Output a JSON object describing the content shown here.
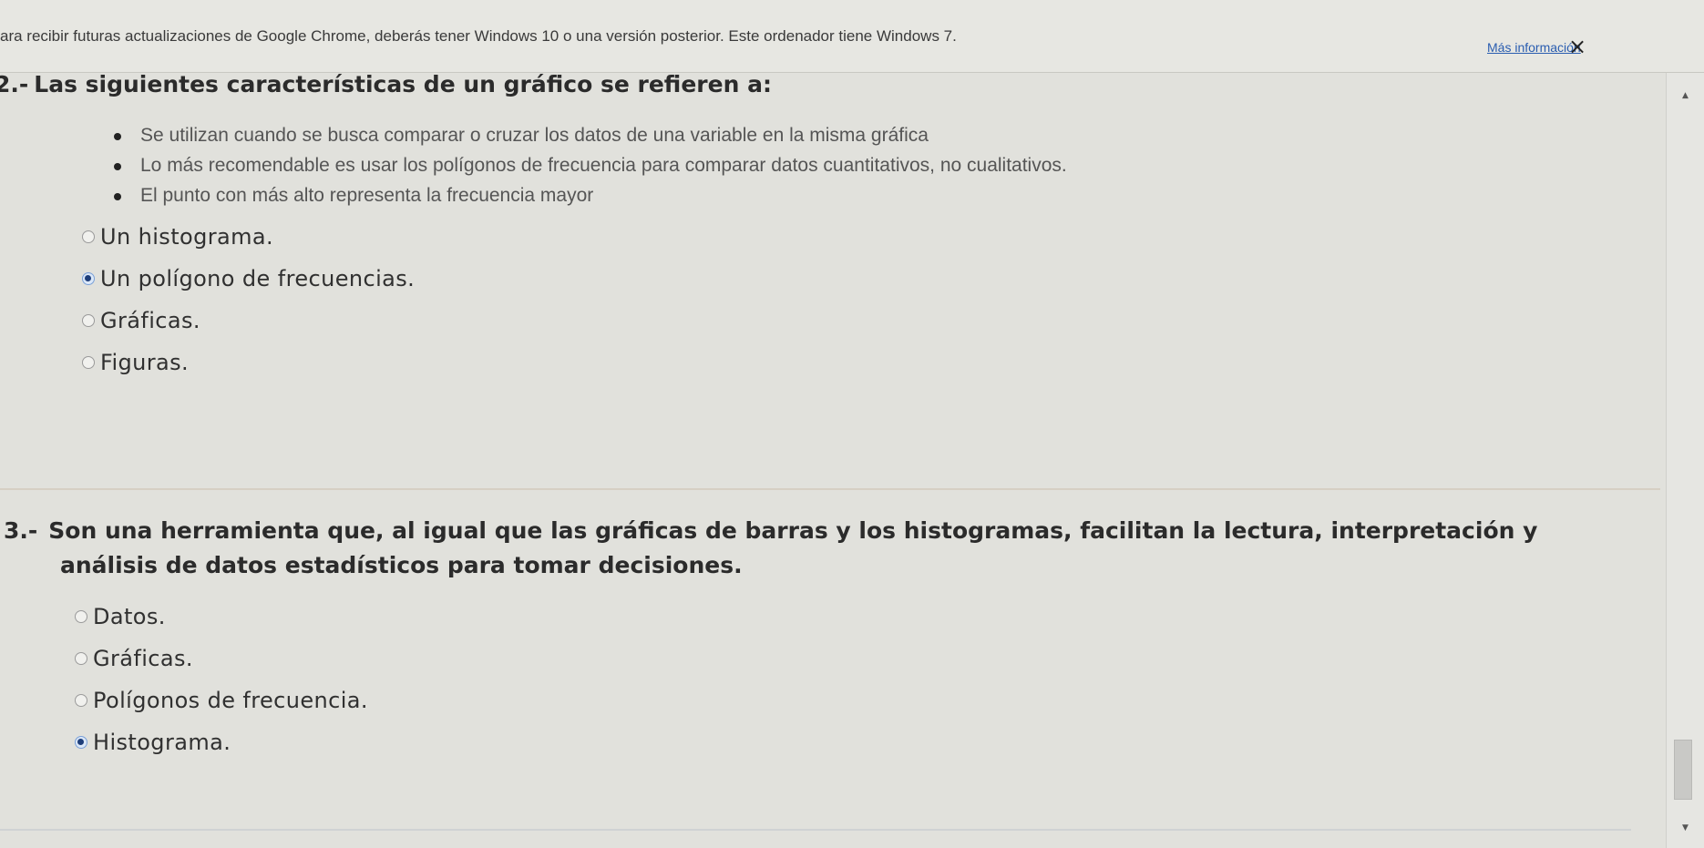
{
  "infobar": {
    "message": "ara recibir futuras actualizaciones de Google Chrome, deberás tener Windows 10 o una versión posterior. Este ordenador tiene Windows 7.",
    "link_label": "Más información",
    "close_glyph": "×"
  },
  "questions": [
    {
      "number": "2.-",
      "title": "Las siguientes características de un gráfico se refieren a:",
      "bullets": [
        "Se utilizan cuando se busca comparar o cruzar los datos de una variable en la misma gráfica",
        "Lo más recomendable es usar los polígonos de frecuencia para comparar datos cuantitativos, no cualitativos.",
        "El punto con más alto representa la frecuencia mayor"
      ],
      "options": [
        {
          "label": "Un histograma.",
          "selected": false
        },
        {
          "label": "Un polígono de frecuencias.",
          "selected": true
        },
        {
          "label": "Gráficas.",
          "selected": false
        },
        {
          "label": "Figuras.",
          "selected": false
        }
      ]
    },
    {
      "number": "3.-",
      "title": "Son una herramienta que, al igual que las gráficas de barras y los histogramas, facilitan la lectura, interpretación y análisis de datos estadísticos para tomar decisiones.",
      "options": [
        {
          "label": "Datos.",
          "selected": false
        },
        {
          "label": "Gráficas.",
          "selected": false
        },
        {
          "label": "Polígonos de frecuencia.",
          "selected": false
        },
        {
          "label": "Histograma.",
          "selected": true
        }
      ]
    }
  ],
  "scrollbar": {
    "up_glyph": "▲",
    "down_glyph": "▼"
  },
  "icons": {
    "close": "close-icon",
    "radio": "radio-button",
    "scroll_up": "arrow-up-icon",
    "scroll_down": "arrow-down-icon"
  }
}
